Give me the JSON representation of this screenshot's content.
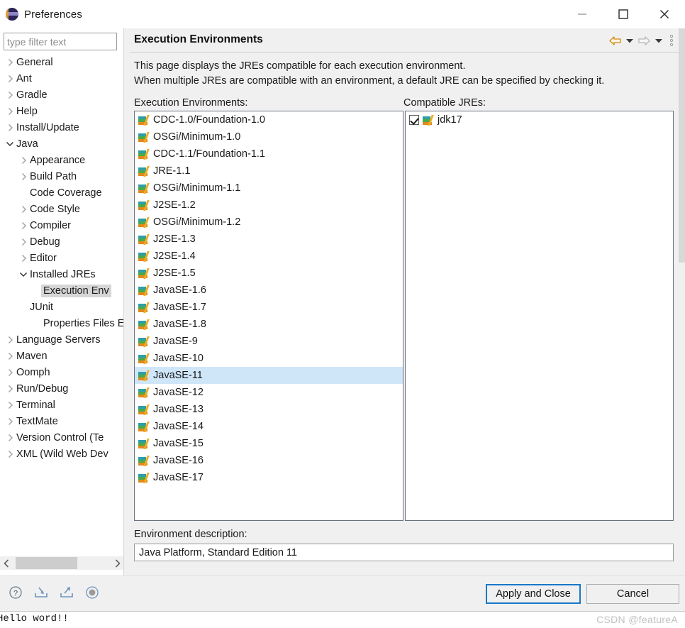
{
  "window": {
    "title": "Preferences",
    "logo_icon": "eclipse-logo",
    "minimize_icon": "minimize-icon",
    "maximize_icon": "maximize-icon",
    "close_icon": "close-icon"
  },
  "sidebar": {
    "filter_placeholder": "type filter text",
    "filter_value": "",
    "scrollbar": {
      "left_arrow_icon": "chevron-left-icon",
      "right_arrow_icon": "chevron-right-icon"
    },
    "items": [
      {
        "label": "General",
        "indent": 0,
        "state": "collapsed",
        "selected": false
      },
      {
        "label": "Ant",
        "indent": 0,
        "state": "collapsed",
        "selected": false
      },
      {
        "label": "Gradle",
        "indent": 0,
        "state": "collapsed",
        "selected": false
      },
      {
        "label": "Help",
        "indent": 0,
        "state": "collapsed",
        "selected": false
      },
      {
        "label": "Install/Update",
        "indent": 0,
        "state": "collapsed",
        "selected": false
      },
      {
        "label": "Java",
        "indent": 0,
        "state": "expanded",
        "selected": false
      },
      {
        "label": "Appearance",
        "indent": 1,
        "state": "collapsed",
        "selected": false
      },
      {
        "label": "Build Path",
        "indent": 1,
        "state": "collapsed",
        "selected": false
      },
      {
        "label": "Code Coverage",
        "indent": 1,
        "state": "leaf",
        "selected": false
      },
      {
        "label": "Code Style",
        "indent": 1,
        "state": "collapsed",
        "selected": false
      },
      {
        "label": "Compiler",
        "indent": 1,
        "state": "collapsed",
        "selected": false
      },
      {
        "label": "Debug",
        "indent": 1,
        "state": "collapsed",
        "selected": false
      },
      {
        "label": "Editor",
        "indent": 1,
        "state": "collapsed",
        "selected": false
      },
      {
        "label": "Installed JREs",
        "indent": 1,
        "state": "expanded",
        "selected": false
      },
      {
        "label": "Execution Env",
        "indent": 2,
        "state": "leaf",
        "selected": true
      },
      {
        "label": "JUnit",
        "indent": 1,
        "state": "leaf",
        "selected": false
      },
      {
        "label": "Properties Files E",
        "indent": 2,
        "state": "leaf",
        "selected": false
      },
      {
        "label": "Language Servers",
        "indent": 0,
        "state": "collapsed",
        "selected": false
      },
      {
        "label": "Maven",
        "indent": 0,
        "state": "collapsed",
        "selected": false
      },
      {
        "label": "Oomph",
        "indent": 0,
        "state": "collapsed",
        "selected": false
      },
      {
        "label": "Run/Debug",
        "indent": 0,
        "state": "collapsed",
        "selected": false
      },
      {
        "label": "Terminal",
        "indent": 0,
        "state": "collapsed",
        "selected": false
      },
      {
        "label": "TextMate",
        "indent": 0,
        "state": "collapsed",
        "selected": false
      },
      {
        "label": "Version Control (Te",
        "indent": 0,
        "state": "collapsed",
        "selected": false
      },
      {
        "label": "XML (Wild Web Dev",
        "indent": 0,
        "state": "collapsed",
        "selected": false
      }
    ]
  },
  "content": {
    "title": "Execution Environments",
    "description_line1": "This page displays the JREs compatible for each execution environment.",
    "description_line2": "When multiple JREs are compatible with an environment, a default JRE can be specified by checking it.",
    "nav": {
      "back_icon": "arrow-left-icon",
      "back_dropdown_icon": "chevron-down-icon",
      "forward_icon": "arrow-right-icon",
      "forward_dropdown_icon": "chevron-down-icon",
      "menu_icon": "vertical-dots-icon"
    },
    "environments_label": "Execution Environments:",
    "compatible_label": "Compatible JREs:",
    "environments": [
      {
        "label": "CDC-1.0/Foundation-1.0",
        "selected": false
      },
      {
        "label": "OSGi/Minimum-1.0",
        "selected": false
      },
      {
        "label": "CDC-1.1/Foundation-1.1",
        "selected": false
      },
      {
        "label": "JRE-1.1",
        "selected": false
      },
      {
        "label": "OSGi/Minimum-1.1",
        "selected": false
      },
      {
        "label": "J2SE-1.2",
        "selected": false
      },
      {
        "label": "OSGi/Minimum-1.2",
        "selected": false
      },
      {
        "label": "J2SE-1.3",
        "selected": false
      },
      {
        "label": "J2SE-1.4",
        "selected": false
      },
      {
        "label": "J2SE-1.5",
        "selected": false
      },
      {
        "label": "JavaSE-1.6",
        "selected": false
      },
      {
        "label": "JavaSE-1.7",
        "selected": false
      },
      {
        "label": "JavaSE-1.8",
        "selected": false
      },
      {
        "label": "JavaSE-9",
        "selected": false
      },
      {
        "label": "JavaSE-10",
        "selected": false
      },
      {
        "label": "JavaSE-11",
        "selected": true
      },
      {
        "label": "JavaSE-12",
        "selected": false
      },
      {
        "label": "JavaSE-13",
        "selected": false
      },
      {
        "label": "JavaSE-14",
        "selected": false
      },
      {
        "label": "JavaSE-15",
        "selected": false
      },
      {
        "label": "JavaSE-16",
        "selected": false
      },
      {
        "label": "JavaSE-17",
        "selected": false
      }
    ],
    "compatible_jres": [
      {
        "label": "jdk17",
        "checked": true
      }
    ],
    "env_description_label": "Environment description:",
    "env_description_value": "Java Platform, Standard Edition 11"
  },
  "footer": {
    "help_icon": "help-icon",
    "import_icon": "import-icon",
    "export_icon": "export-icon",
    "restore_defaults_icon": "restore-defaults-icon",
    "apply_label": "Apply and Close",
    "cancel_label": "Cancel"
  },
  "console": {
    "output": "Hello word!!",
    "watermark": "CSDN @featureA"
  },
  "colors": {
    "accent": "#1878c8",
    "selection": "#cfe6f9",
    "tree_selection": "#d6d6d6",
    "dialog_bg": "#f0f0f0",
    "border": "#6b7280"
  }
}
